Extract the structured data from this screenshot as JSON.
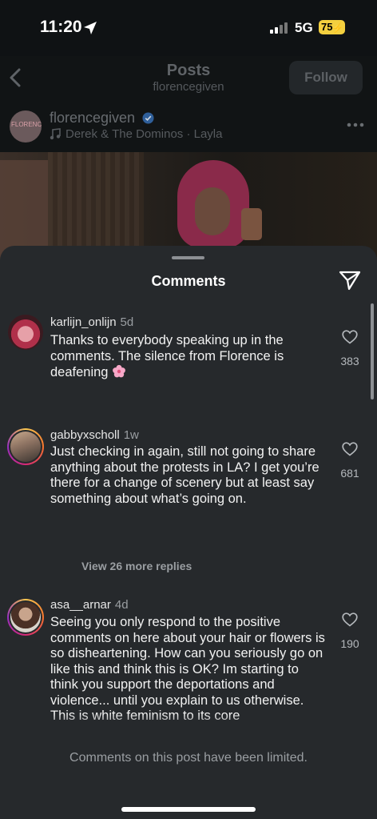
{
  "status_bar": {
    "time": "11:20",
    "network": "5G",
    "battery": "75"
  },
  "header": {
    "title": "Posts",
    "subtitle": "florencegiven",
    "follow_label": "Follow"
  },
  "post": {
    "avatar_text": "FLORENCE GIVEN",
    "username": "florencegiven",
    "song": "Derek & The Dominos · Layla"
  },
  "sheet": {
    "title": "Comments",
    "view_replies": "View 26 more replies",
    "limited_notice": "Comments on this post have been limited."
  },
  "comments": [
    {
      "username": "karlijn_onlijn",
      "time": "5d",
      "text": "Thanks to everybody speaking up in the comments. The silence from Florence is deafening",
      "likes": "383"
    },
    {
      "username": "gabbyxscholl",
      "time": "1w",
      "text": "Just checking in again, still not going to share anything about the protests in LA? I get you’re there for a change of scenery but at least say something about what’s going on.",
      "likes": "681"
    },
    {
      "username": "asa__arnar",
      "time": "4d",
      "text": "Seeing you only respond to the positive comments on here about your hair or flowers is so disheartening. How can you seriously go on like this and think this is OK? Im starting to think you support the deportations and violence... until you explain to us otherwise. This is white feminism to its core",
      "likes": "190"
    }
  ],
  "colors": {
    "sheet_bg": "#26292c",
    "battery": "#f4d03f",
    "verified": "#3897f0"
  }
}
